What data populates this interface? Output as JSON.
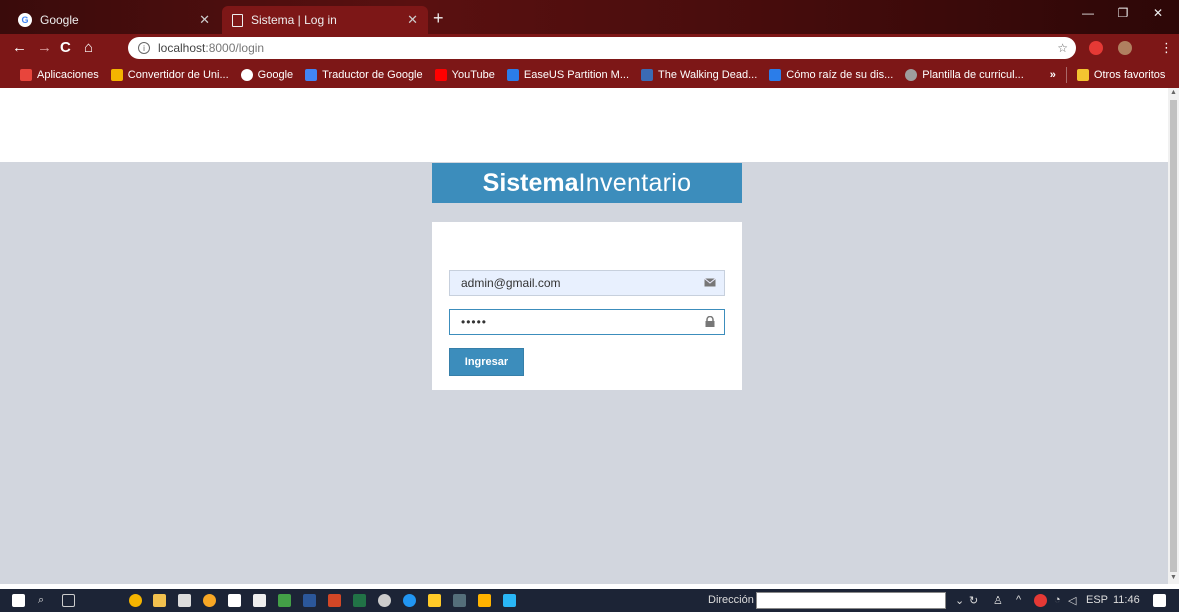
{
  "browser": {
    "tabs": [
      {
        "title": "Google",
        "active": false
      },
      {
        "title": "Sistema | Log in",
        "active": true
      }
    ],
    "url_host": "localhost",
    "url_rest": ":8000/login",
    "bookmarks": [
      {
        "label": "Aplicaciones",
        "color": "#e8453c"
      },
      {
        "label": "Convertidor de Uni...",
        "color": "#f4b400"
      },
      {
        "label": "Google",
        "color": "#ffffff"
      },
      {
        "label": "Traductor de Google",
        "color": "#4285f4"
      },
      {
        "label": "YouTube",
        "color": "#ff0000"
      },
      {
        "label": "EaseUS Partition M...",
        "color": "#2b7de9"
      },
      {
        "label": "The Walking Dead...",
        "color": "#3b6bb5"
      },
      {
        "label": "Cómo raíz de su dis...",
        "color": "#2b7de9"
      },
      {
        "label": "Plantilla de curricul...",
        "color": "#9e9e9e"
      }
    ],
    "bookmarks_more": "»",
    "other_bookmarks": "Otros favoritos"
  },
  "page": {
    "logo_bold": "Sistema",
    "logo_light": "Inventario",
    "email_value": "admin@gmail.com",
    "password_value": "•••••",
    "submit_label": "Ingresar"
  },
  "taskbar": {
    "address_label": "Dirección",
    "language": "ESP",
    "time": "11:46"
  },
  "colors": {
    "accent": "#3c8dbc",
    "login_bg": "#d2d6de",
    "browser_frame": "#7d1717"
  }
}
